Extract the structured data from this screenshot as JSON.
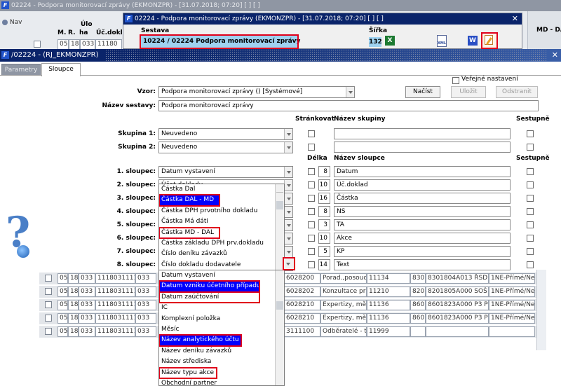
{
  "bg_window": {
    "title": "02224 - Podpora monitorovací zprávy (EKMONZPR) - [31.07.2018; 07:20]  [ ]  [ ]",
    "nav_label": "Nav",
    "col_m": "M.",
    "col_r": "R.",
    "col_uloha": [
      "Úlo",
      "ha"
    ],
    "col_ucdokl": "Úč.dokl",
    "first_row": [
      "05",
      "18",
      "033",
      "11180"
    ],
    "right_col": "MD - DA"
  },
  "popup_window": {
    "title": "02224 - Podpora monitorovací zprávy (EKMONZPR) - [31.07.2018; 07:20]  [ ]  [ ]",
    "col_sestava": "Sestava",
    "col_sirka": "Šířka",
    "sestava_value": "10224 / 02224   Podpora monitorovací zprávy",
    "sirka_value": "132",
    "xml_label": "XML",
    "word_label": "W"
  },
  "dialog": {
    "title": "/02224 - (RJ_EKMONZPR)",
    "tabs": [
      "Parametry",
      "Sloupce"
    ],
    "verejne": "Veřejné nastavení",
    "vzor_label": "Vzor:",
    "vzor_value": "Podpora monitorovací zprávy   ()   [Systémové]",
    "nacist": "Načíst",
    "ulozit": "Uložit",
    "odstranit": "Odstranit",
    "nazev_sestavy_label": "Název sestavy:",
    "nazev_sestavy_value": "Podpora monitorovací zprávy",
    "hdr_strankovat": "Stránkovat",
    "hdr_nazev_skupiny": "Název skupiny",
    "hdr_sestupne": "Sestupně",
    "skupina1_label": "Skupina 1:",
    "skupina1_value": "Neuvedeno",
    "skupina2_label": "Skupina 2:",
    "skupina2_value": "Neuvedeno",
    "hdr_delka": "Délka",
    "hdr_nazev_sloupce": "Název sloupce",
    "hdr_sestupne2": "Sestupně",
    "columns": [
      {
        "label": "1. sloupec:",
        "value": "Datum vystavení",
        "len": "8",
        "name": "Datum"
      },
      {
        "label": "2. sloupec:",
        "value": "Účet dokladu",
        "len": "10",
        "name": "Úč.doklad"
      },
      {
        "label": "3. sloupec:",
        "value": "",
        "len": "16",
        "name": "Částka"
      },
      {
        "label": "4. sloupec:",
        "value": "",
        "len": "8",
        "name": "NS"
      },
      {
        "label": "5. sloupec:",
        "value": "",
        "len": "3",
        "name": "TA"
      },
      {
        "label": "6. sloupec:",
        "value": "",
        "len": "10",
        "name": "Akce"
      },
      {
        "label": "7. sloupec:",
        "value": "",
        "len": "5",
        "name": "KP"
      },
      {
        "label": "8. sloupec:",
        "value": "",
        "len": "14",
        "name": "Text"
      }
    ]
  },
  "dropdown_top": [
    "Částka Dal",
    "Částka DAL - MD",
    "Částka DPH prvotního dokladu",
    "Částka Má dáti",
    "Částka MD - DAL",
    "Částka základu DPH prv.dokladu",
    "Číslo deníku závazků",
    "Číslo dokladu dodavatele"
  ],
  "dropdown_bottom": [
    "Datum vystavení",
    "Datum vzniku účetního případu",
    "Datum zaúčtování",
    "IC",
    "Komplexní položka",
    "Měsíc",
    "Název analytického účtu",
    "Název deníku závazků",
    "Název střediska",
    "Název typu akce",
    "Obchodní partner"
  ],
  "grid_rows": [
    {
      "m": "05",
      "r": "18",
      "u": "033",
      "doc": "1118031111",
      "a": "033",
      "code": "6028200",
      "text": "Porad.,posoud",
      "acc": "11134",
      "n": "830",
      "ref": "8301804A013 ŘSD",
      "type": "1NE-Přímé/Ner"
    },
    {
      "m": "05",
      "r": "18",
      "u": "033",
      "doc": "1118031111",
      "a": "033",
      "code": "6028202",
      "text": "Konzultace pr",
      "acc": "11210",
      "n": "820",
      "ref": "8201805A000 SOŠ",
      "type": "1NE-Přímé/Ner"
    },
    {
      "m": "05",
      "r": "18",
      "u": "033",
      "doc": "1118031111",
      "a": "033",
      "code": "6028210",
      "text": "Expertizy, mě",
      "acc": "11136",
      "n": "860",
      "ref": "8601823A000 P3 PI",
      "type": "1NE-Přímé/Ner"
    },
    {
      "m": "05",
      "r": "18",
      "u": "033",
      "doc": "1118031111",
      "a": "033",
      "code": "6028210",
      "text": "Expertizy, mě",
      "acc": "11136",
      "n": "860",
      "ref": "8601823A000 P3 PI",
      "type": "1NE-Přímé/Ner"
    },
    {
      "m": "05",
      "r": "18",
      "u": "033",
      "doc": "1118031111",
      "a": "033",
      "code": "3111100",
      "text": "Odběratelé - t",
      "acc": "11999",
      "n": "",
      "ref": "",
      "type": ""
    }
  ],
  "colors": {
    "highlight": "#e0001b",
    "selection": "#0000ff",
    "title_blue": "#0a246a"
  }
}
